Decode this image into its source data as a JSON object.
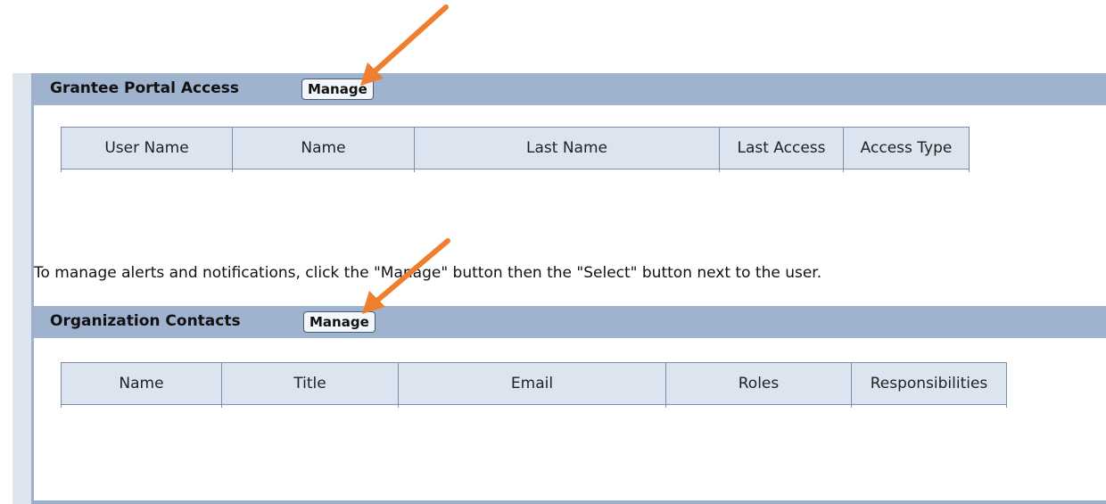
{
  "portal_access": {
    "title": "Grantee Portal Access",
    "manage_label": "Manage",
    "columns": [
      "User Name",
      "Name",
      "Last Name",
      "Last Access",
      "Access Type"
    ]
  },
  "info_text": "To manage alerts and notifications, click the \"Manage\" button then the \"Select\" button next to the user.",
  "contacts": {
    "title": "Organization Contacts",
    "manage_label": "Manage",
    "columns": [
      "Name",
      "Title",
      "Email",
      "Roles",
      "Responsibilities"
    ]
  },
  "annotation_color": "#ef7f2f"
}
